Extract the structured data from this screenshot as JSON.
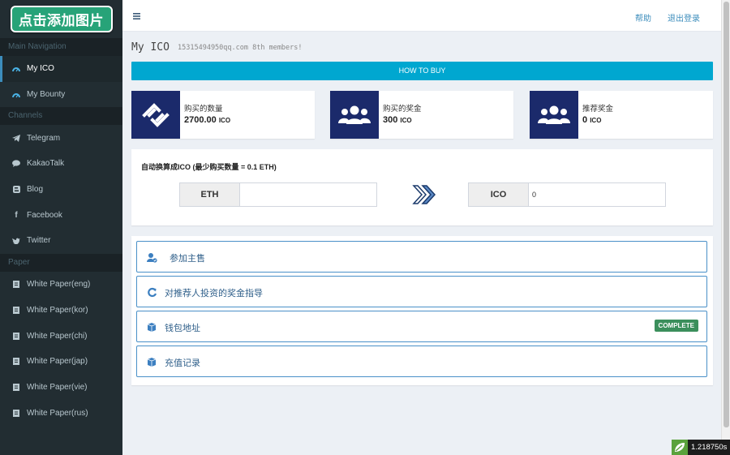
{
  "logo": {
    "label": "点击添加图片"
  },
  "sidebar": {
    "sections": [
      {
        "header": "Main Navigation",
        "items": [
          {
            "label": "My ICO",
            "icon": "dashboard-icon",
            "active": true
          },
          {
            "label": "My Bounty",
            "icon": "dashboard-icon",
            "active": false
          }
        ]
      },
      {
        "header": "Channels",
        "items": [
          {
            "label": "Telegram",
            "icon": "telegram-icon"
          },
          {
            "label": "KakaoTalk",
            "icon": "chat-bubble-icon"
          },
          {
            "label": "Blog",
            "icon": "blog-icon"
          },
          {
            "label": "Facebook",
            "icon": "facebook-icon"
          },
          {
            "label": "Twitter",
            "icon": "twitter-icon"
          }
        ]
      },
      {
        "header": "Paper",
        "items": [
          {
            "label": "White Paper(eng)",
            "icon": "document-icon"
          },
          {
            "label": "White Paper(kor)",
            "icon": "document-icon"
          },
          {
            "label": "White Paper(chi)",
            "icon": "document-icon"
          },
          {
            "label": "White Paper(jap)",
            "icon": "document-icon"
          },
          {
            "label": "White Paper(vie)",
            "icon": "document-icon"
          },
          {
            "label": "White Paper(rus)",
            "icon": "document-icon"
          }
        ]
      }
    ]
  },
  "topbar": {
    "help": "帮助",
    "logout": "退出登录"
  },
  "page": {
    "title": "My ICO",
    "subtitle": "15315494950qq.com 8th members!"
  },
  "how_to_buy": "HOW TO BUY",
  "info_boxes": [
    {
      "label": "购买的数量",
      "value": "2700.00",
      "unit": "ICO",
      "icon": "exchange-icon"
    },
    {
      "label": "购买的奖金",
      "value": "300",
      "unit": "ICO",
      "icon": "users-icon"
    },
    {
      "label": "推荐奖金",
      "value": "0",
      "unit": "ICO",
      "icon": "users-icon"
    }
  ],
  "convert": {
    "title": "自动换算成ICO (最少购买数量 = 0.1 ETH)",
    "from_label": "ETH",
    "from_value": "",
    "to_label": "ICO",
    "to_value": "0"
  },
  "list_rows": [
    {
      "label": "参加主售",
      "icon": "user-check-icon",
      "badge": ""
    },
    {
      "label": "对推荐人投资的奖金指导",
      "icon": "refresh-icon",
      "badge": ""
    },
    {
      "label": "钱包地址",
      "icon": "cube-icon",
      "badge": "COMPLETE"
    },
    {
      "label": "充值记录",
      "icon": "cube-icon",
      "badge": ""
    }
  ],
  "colors": {
    "sidebar_bg": "#222d32",
    "accent": "#00a7d0",
    "info_icon_bg": "#1b2a6b",
    "badge_green": "#3b8f5c",
    "link_blue": "#3c8dbc"
  },
  "timer": "1.218750s"
}
